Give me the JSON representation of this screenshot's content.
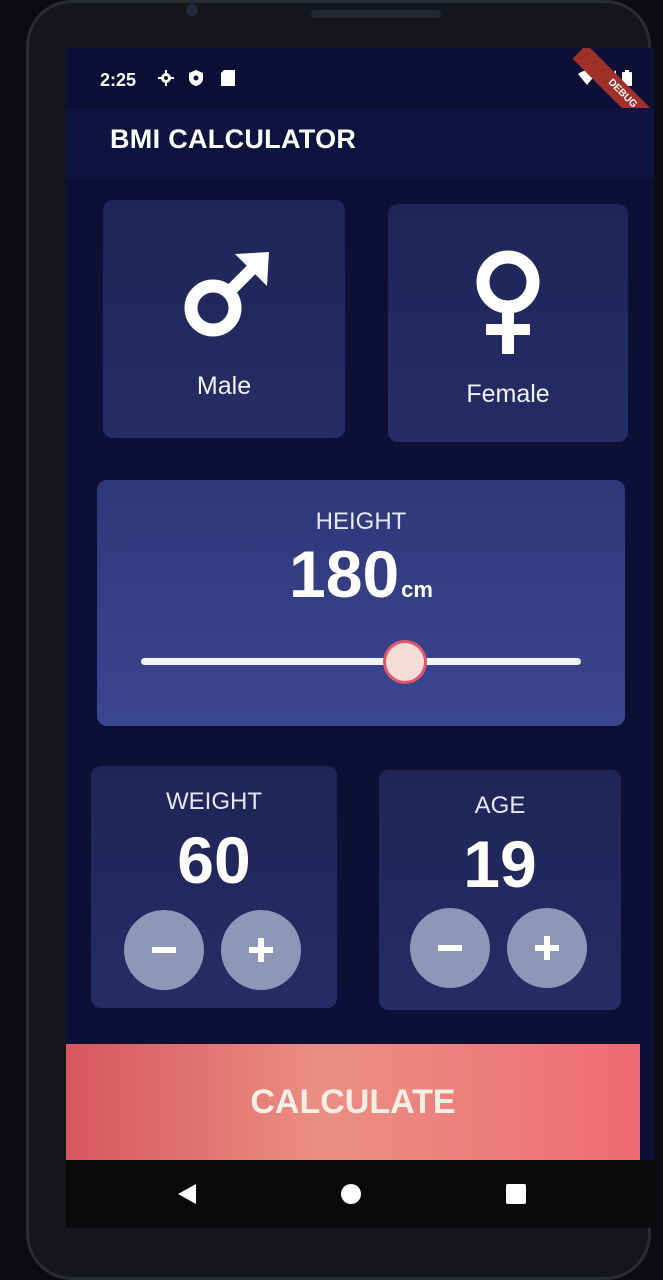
{
  "status_bar": {
    "time": "2:25",
    "left_icons": [
      "gear-icon",
      "shield-icon",
      "sim-card-icon"
    ],
    "right_icons": [
      "wifi-icon",
      "signal-icon",
      "battery-icon"
    ]
  },
  "debug_banner": "DEBUG",
  "app_title": "BMI CALCULATOR",
  "gender": {
    "male_label": "Male",
    "female_label": "Female"
  },
  "height": {
    "label": "HEIGHT",
    "value": "180",
    "unit": "cm",
    "slider_fraction": 0.6
  },
  "weight": {
    "label": "WEIGHT",
    "value": "60"
  },
  "age": {
    "label": "AGE",
    "value": "19"
  },
  "calculate_label": "CALCULATE",
  "colors": {
    "background": "#0d1036",
    "card": "#262d66",
    "accent": "#e0566a",
    "calculate": "#eb6b6f"
  }
}
